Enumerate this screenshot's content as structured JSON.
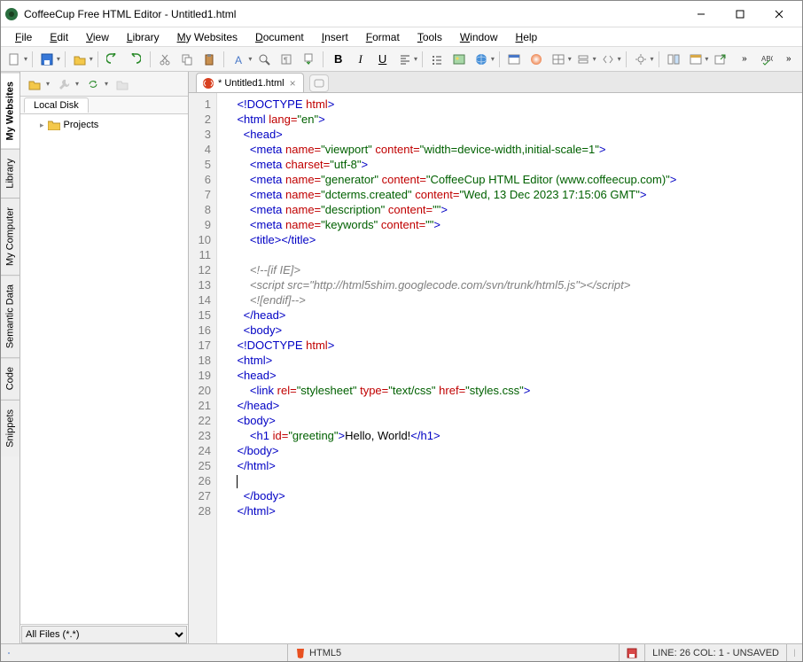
{
  "window": {
    "title": "CoffeeCup Free HTML Editor - Untitled1.html"
  },
  "menu": [
    "File",
    "Edit",
    "View",
    "Library",
    "My Websites",
    "Document",
    "Insert",
    "Format",
    "Tools",
    "Window",
    "Help"
  ],
  "sidetabs": [
    "My Websites",
    "Library",
    "My Computer",
    "Semantic Data",
    "Code",
    "Snippets"
  ],
  "sidepanel": {
    "tab": "Local Disk",
    "tree_item": "Projects",
    "filter": "All Files (*.*)"
  },
  "tab": {
    "name": "* Untitled1.html"
  },
  "gutter_lines": 28,
  "code_lines": [
    {
      "i": 4,
      "seg": [
        [
          "tag",
          "<!DOCTYPE"
        ],
        [
          "txt",
          " "
        ],
        [
          "attr",
          "html"
        ],
        [
          "tag",
          ">"
        ]
      ]
    },
    {
      "i": 4,
      "seg": [
        [
          "tag",
          "<html"
        ],
        [
          "txt",
          " "
        ],
        [
          "attr",
          "lang="
        ],
        [
          "val",
          "\"en\""
        ],
        [
          "tag",
          ">"
        ]
      ]
    },
    {
      "i": 6,
      "seg": [
        [
          "tag",
          "<head>"
        ]
      ]
    },
    {
      "i": 8,
      "seg": [
        [
          "tag",
          "<meta"
        ],
        [
          "txt",
          " "
        ],
        [
          "attr",
          "name="
        ],
        [
          "val",
          "\"viewport\""
        ],
        [
          "txt",
          " "
        ],
        [
          "attr",
          "content="
        ],
        [
          "val",
          "\"width=device-width,initial-scale=1\""
        ],
        [
          "tag",
          ">"
        ]
      ]
    },
    {
      "i": 8,
      "seg": [
        [
          "tag",
          "<meta"
        ],
        [
          "txt",
          " "
        ],
        [
          "attr",
          "charset="
        ],
        [
          "val",
          "\"utf-8\""
        ],
        [
          "tag",
          ">"
        ]
      ]
    },
    {
      "i": 8,
      "seg": [
        [
          "tag",
          "<meta"
        ],
        [
          "txt",
          " "
        ],
        [
          "attr",
          "name="
        ],
        [
          "val",
          "\"generator\""
        ],
        [
          "txt",
          " "
        ],
        [
          "attr",
          "content="
        ],
        [
          "val",
          "\"CoffeeCup HTML Editor (www.coffeecup.com)\""
        ],
        [
          "tag",
          ">"
        ]
      ]
    },
    {
      "i": 8,
      "seg": [
        [
          "tag",
          "<meta"
        ],
        [
          "txt",
          " "
        ],
        [
          "attr",
          "name="
        ],
        [
          "val",
          "\"dcterms.created\""
        ],
        [
          "txt",
          " "
        ],
        [
          "attr",
          "content="
        ],
        [
          "val",
          "\"Wed, 13 Dec 2023 17:15:06 GMT\""
        ],
        [
          "tag",
          ">"
        ]
      ]
    },
    {
      "i": 8,
      "seg": [
        [
          "tag",
          "<meta"
        ],
        [
          "txt",
          " "
        ],
        [
          "attr",
          "name="
        ],
        [
          "val",
          "\"description\""
        ],
        [
          "txt",
          " "
        ],
        [
          "attr",
          "content="
        ],
        [
          "val",
          "\"\""
        ],
        [
          "tag",
          ">"
        ]
      ]
    },
    {
      "i": 8,
      "seg": [
        [
          "tag",
          "<meta"
        ],
        [
          "txt",
          " "
        ],
        [
          "attr",
          "name="
        ],
        [
          "val",
          "\"keywords\""
        ],
        [
          "txt",
          " "
        ],
        [
          "attr",
          "content="
        ],
        [
          "val",
          "\"\""
        ],
        [
          "tag",
          ">"
        ]
      ]
    },
    {
      "i": 8,
      "seg": [
        [
          "tag",
          "<title></title>"
        ]
      ]
    },
    {
      "i": 0,
      "seg": []
    },
    {
      "i": 8,
      "seg": [
        [
          "com",
          "<!--[if IE]>"
        ]
      ]
    },
    {
      "i": 8,
      "seg": [
        [
          "com",
          "<script src=\"http://html5shim.googlecode.com/svn/trunk/html5.js\"></script>"
        ]
      ]
    },
    {
      "i": 8,
      "seg": [
        [
          "com",
          "<![endif]-->"
        ]
      ]
    },
    {
      "i": 6,
      "seg": [
        [
          "tag",
          "</head>"
        ]
      ]
    },
    {
      "i": 6,
      "seg": [
        [
          "tag",
          "<body>"
        ]
      ]
    },
    {
      "i": 4,
      "seg": [
        [
          "tag",
          "<!DOCTYPE"
        ],
        [
          "txt",
          " "
        ],
        [
          "attr",
          "html"
        ],
        [
          "tag",
          ">"
        ]
      ]
    },
    {
      "i": 4,
      "seg": [
        [
          "tag",
          "<html>"
        ]
      ]
    },
    {
      "i": 4,
      "seg": [
        [
          "tag",
          "<head>"
        ]
      ]
    },
    {
      "i": 8,
      "seg": [
        [
          "tag",
          "<link"
        ],
        [
          "txt",
          " "
        ],
        [
          "attr",
          "rel="
        ],
        [
          "val",
          "\"stylesheet\""
        ],
        [
          "txt",
          " "
        ],
        [
          "attr",
          "type="
        ],
        [
          "val",
          "\"text/css\""
        ],
        [
          "txt",
          " "
        ],
        [
          "attr",
          "href="
        ],
        [
          "val",
          "\"styles.css\""
        ],
        [
          "tag",
          ">"
        ]
      ]
    },
    {
      "i": 4,
      "seg": [
        [
          "tag",
          "</head>"
        ]
      ]
    },
    {
      "i": 4,
      "seg": [
        [
          "tag",
          "<body>"
        ]
      ]
    },
    {
      "i": 8,
      "seg": [
        [
          "tag",
          "<h1"
        ],
        [
          "txt",
          " "
        ],
        [
          "attr",
          "id="
        ],
        [
          "val",
          "\"greeting\""
        ],
        [
          "tag",
          ">"
        ],
        [
          "txt",
          "Hello, World!"
        ],
        [
          "tag",
          "</h1>"
        ]
      ]
    },
    {
      "i": 4,
      "seg": [
        [
          "tag",
          "</body>"
        ]
      ]
    },
    {
      "i": 4,
      "seg": [
        [
          "tag",
          "</html>"
        ]
      ]
    },
    {
      "i": 4,
      "seg": [],
      "cursor": true
    },
    {
      "i": 6,
      "seg": [
        [
          "tag",
          "</body>"
        ]
      ]
    },
    {
      "i": 4,
      "seg": [
        [
          "tag",
          "</html>"
        ]
      ]
    }
  ],
  "status": {
    "lang": "HTML5",
    "pos": "LINE: 26  COL: 1 - UNSAVED"
  }
}
